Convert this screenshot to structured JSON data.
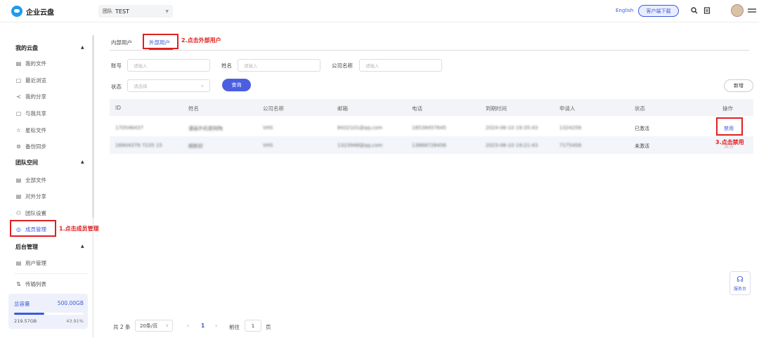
{
  "app": {
    "logo_text": "企业云盘"
  },
  "header": {
    "team_label": "团队",
    "team_value": "TEST",
    "lang_link": "English",
    "download_button": "客户端下载",
    "icons": [
      "search-icon",
      "document-icon",
      "avatar",
      "menu-icon"
    ]
  },
  "sidebar": {
    "section_my": "我的云盘",
    "my_items": [
      {
        "label": "我的文件",
        "icon": "file-icon"
      },
      {
        "label": "最近浏览",
        "icon": "recent-icon"
      },
      {
        "label": "我的分享",
        "icon": "share-icon"
      },
      {
        "label": "与我共享",
        "icon": "shared-with-me-icon"
      },
      {
        "label": "星标文件",
        "icon": "star-icon"
      },
      {
        "label": "备份同步",
        "icon": "sync-icon"
      }
    ],
    "section_team": "团队空间",
    "team_items": [
      {
        "label": "全部文件",
        "icon": "folder-icon"
      },
      {
        "label": "对外分享",
        "icon": "external-share-icon"
      },
      {
        "label": "团队设置",
        "icon": "team-settings-icon"
      },
      {
        "label": "成员管理",
        "icon": "members-icon",
        "active": true
      }
    ],
    "section_admin": "后台管理",
    "admin_items": [
      {
        "label": "用户管理",
        "icon": "user-admin-icon"
      }
    ],
    "transfer_list": "传输列表",
    "storage": {
      "total_label": "总容量",
      "total_value": "500.00GB",
      "used_value": "219.57GB",
      "used_percent": "43.91%",
      "used_fraction": 0.4391
    }
  },
  "annotations": {
    "step1": "1.点击成员管理",
    "step2": "2.点击外部用户",
    "step3": "3.点击禁用"
  },
  "tabs": [
    {
      "label": "内部用户"
    },
    {
      "label": "外部用户",
      "active": true
    }
  ],
  "filters": {
    "account_label": "账号",
    "account_placeholder": "请输入",
    "name_label": "姓名",
    "name_placeholder": "请输入",
    "company_label": "公司名称",
    "company_placeholder": "请输入",
    "status_label": "状态",
    "status_placeholder": "请选择",
    "search_button": "查询",
    "add_button": "新增"
  },
  "table": {
    "columns": [
      "ID",
      "姓名",
      "公司名称",
      "邮箱",
      "电话",
      "到期时间",
      "申请人",
      "状态",
      "操作"
    ],
    "rows": [
      {
        "id": "170546437",
        "name": "漫画外机密网陶",
        "company": "VHS",
        "email": "8432101@qq.com",
        "phone": "18538457645",
        "expire": "2024-06-10 19:35:43",
        "applicant": "1324256",
        "status": "已激活",
        "action": "禁用"
      },
      {
        "id": "16904379 7235 15",
        "name": "越新好",
        "company": "VHS",
        "email": "1323948@qq.com",
        "phone": "13868726456",
        "expire": "2023-06-10 19:21:43",
        "applicant": "7175456",
        "status": "未激活",
        "action": "激活"
      }
    ]
  },
  "pagination": {
    "total_text": "共 2 条",
    "page_size": "20条/页",
    "current_page": "1",
    "goto_label": "前往",
    "goto_value": "1",
    "page_suffix": "页"
  },
  "service": {
    "label": "服务台"
  }
}
